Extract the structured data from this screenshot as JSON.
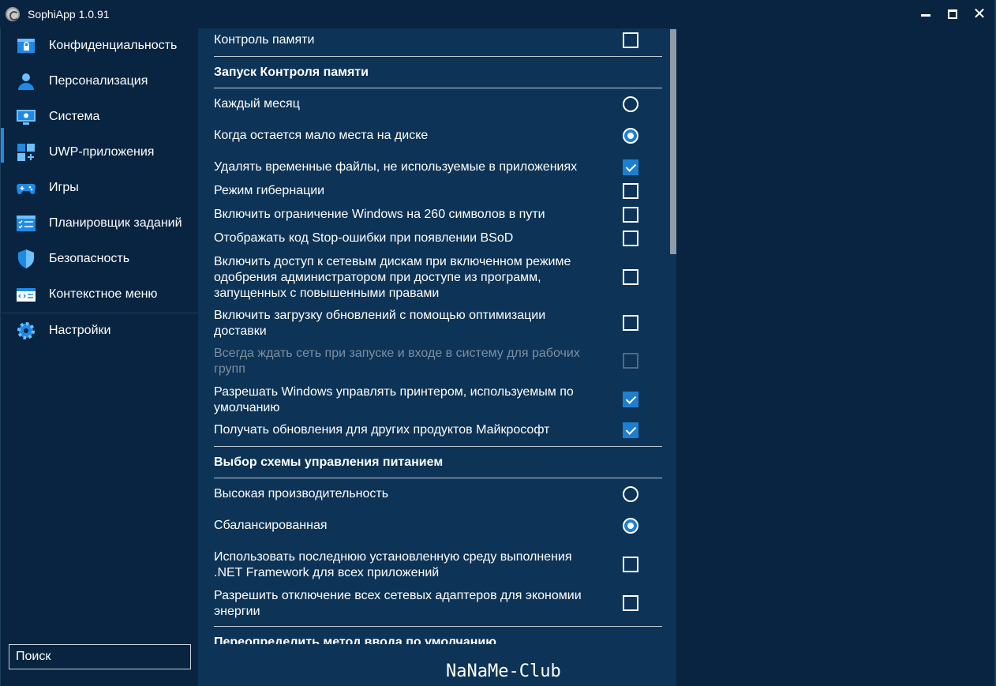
{
  "app": {
    "title": "SophiApp 1.0.91"
  },
  "window_controls": {
    "minimize": "minimize",
    "maximize": "maximize",
    "close": "close"
  },
  "sidebar": {
    "items": [
      {
        "label": "Конфиденциальность",
        "icon": "privacy-icon"
      },
      {
        "label": "Персонализация",
        "icon": "person-icon"
      },
      {
        "label": "Система",
        "icon": "monitor-icon",
        "active": true
      },
      {
        "label": "UWP-приложения",
        "icon": "apps-grid-icon"
      },
      {
        "label": "Игры",
        "icon": "gamepad-icon"
      },
      {
        "label": "Планировщик заданий",
        "icon": "task-list-icon"
      },
      {
        "label": "Безопасность",
        "icon": "shield-icon"
      },
      {
        "label": "Контекстное меню",
        "icon": "code-window-icon"
      },
      {
        "label": "Настройки",
        "icon": "gear-icon"
      }
    ],
    "search": {
      "value": "Поиск",
      "placeholder": "Поиск"
    }
  },
  "settings": {
    "storage_sense": {
      "label": "Контроль памяти",
      "checked": false
    },
    "storage_sense_section": "Запуск Контроля памяти",
    "every_month": {
      "label": "Каждый месяц",
      "selected": false
    },
    "low_disk": {
      "label": "Когда остается мало места на диске",
      "selected": true
    },
    "delete_temp": {
      "label": "Удалять временные файлы, не используемые в приложениях",
      "checked": true
    },
    "hibernation": {
      "label": "Режим гибернации",
      "checked": false
    },
    "long_paths": {
      "label": "Включить ограничение Windows на 260 символов в пути",
      "checked": false
    },
    "bsod_code": {
      "label": "Отображать код Stop-ошибки при появлении BSoD",
      "checked": false
    },
    "network_drives": {
      "label": "Включить доступ к сетевым дискам при включенном режиме одобрения администратором при доступе из программ, запущенных с повышенными правами",
      "checked": false
    },
    "delivery_opt": {
      "label": "Включить загрузку обновлений с помощью оптимизации доставки",
      "checked": false
    },
    "wait_network": {
      "label": "Всегда ждать сеть при запуске и входе в систему для рабочих групп",
      "checked": false,
      "disabled": true
    },
    "printer": {
      "label": "Разрешать Windows управлять принтером, используемым по умолчанию",
      "checked": true
    },
    "ms_updates": {
      "label": "Получать обновления для других продуктов Майкрософт",
      "checked": true
    },
    "power_section": "Выбор схемы управления питанием",
    "high_perf": {
      "label": "Высокая производительность",
      "selected": false
    },
    "balanced": {
      "label": "Сбалансированная",
      "selected": true
    },
    "dotnet": {
      "label": "Использовать последнюю установленную среду выполнения .NET Framework для всех приложений",
      "checked": false
    },
    "adapters": {
      "label": "Разрешить отключение всех сетевых адаптеров для экономии энергии",
      "checked": false
    },
    "input_section": "Переопределить метод ввода по умолчанию"
  },
  "watermark": "NaNaMe-Club",
  "colors": {
    "background": "#082440",
    "content": "#0d3356",
    "accent": "#1e7fd0"
  }
}
